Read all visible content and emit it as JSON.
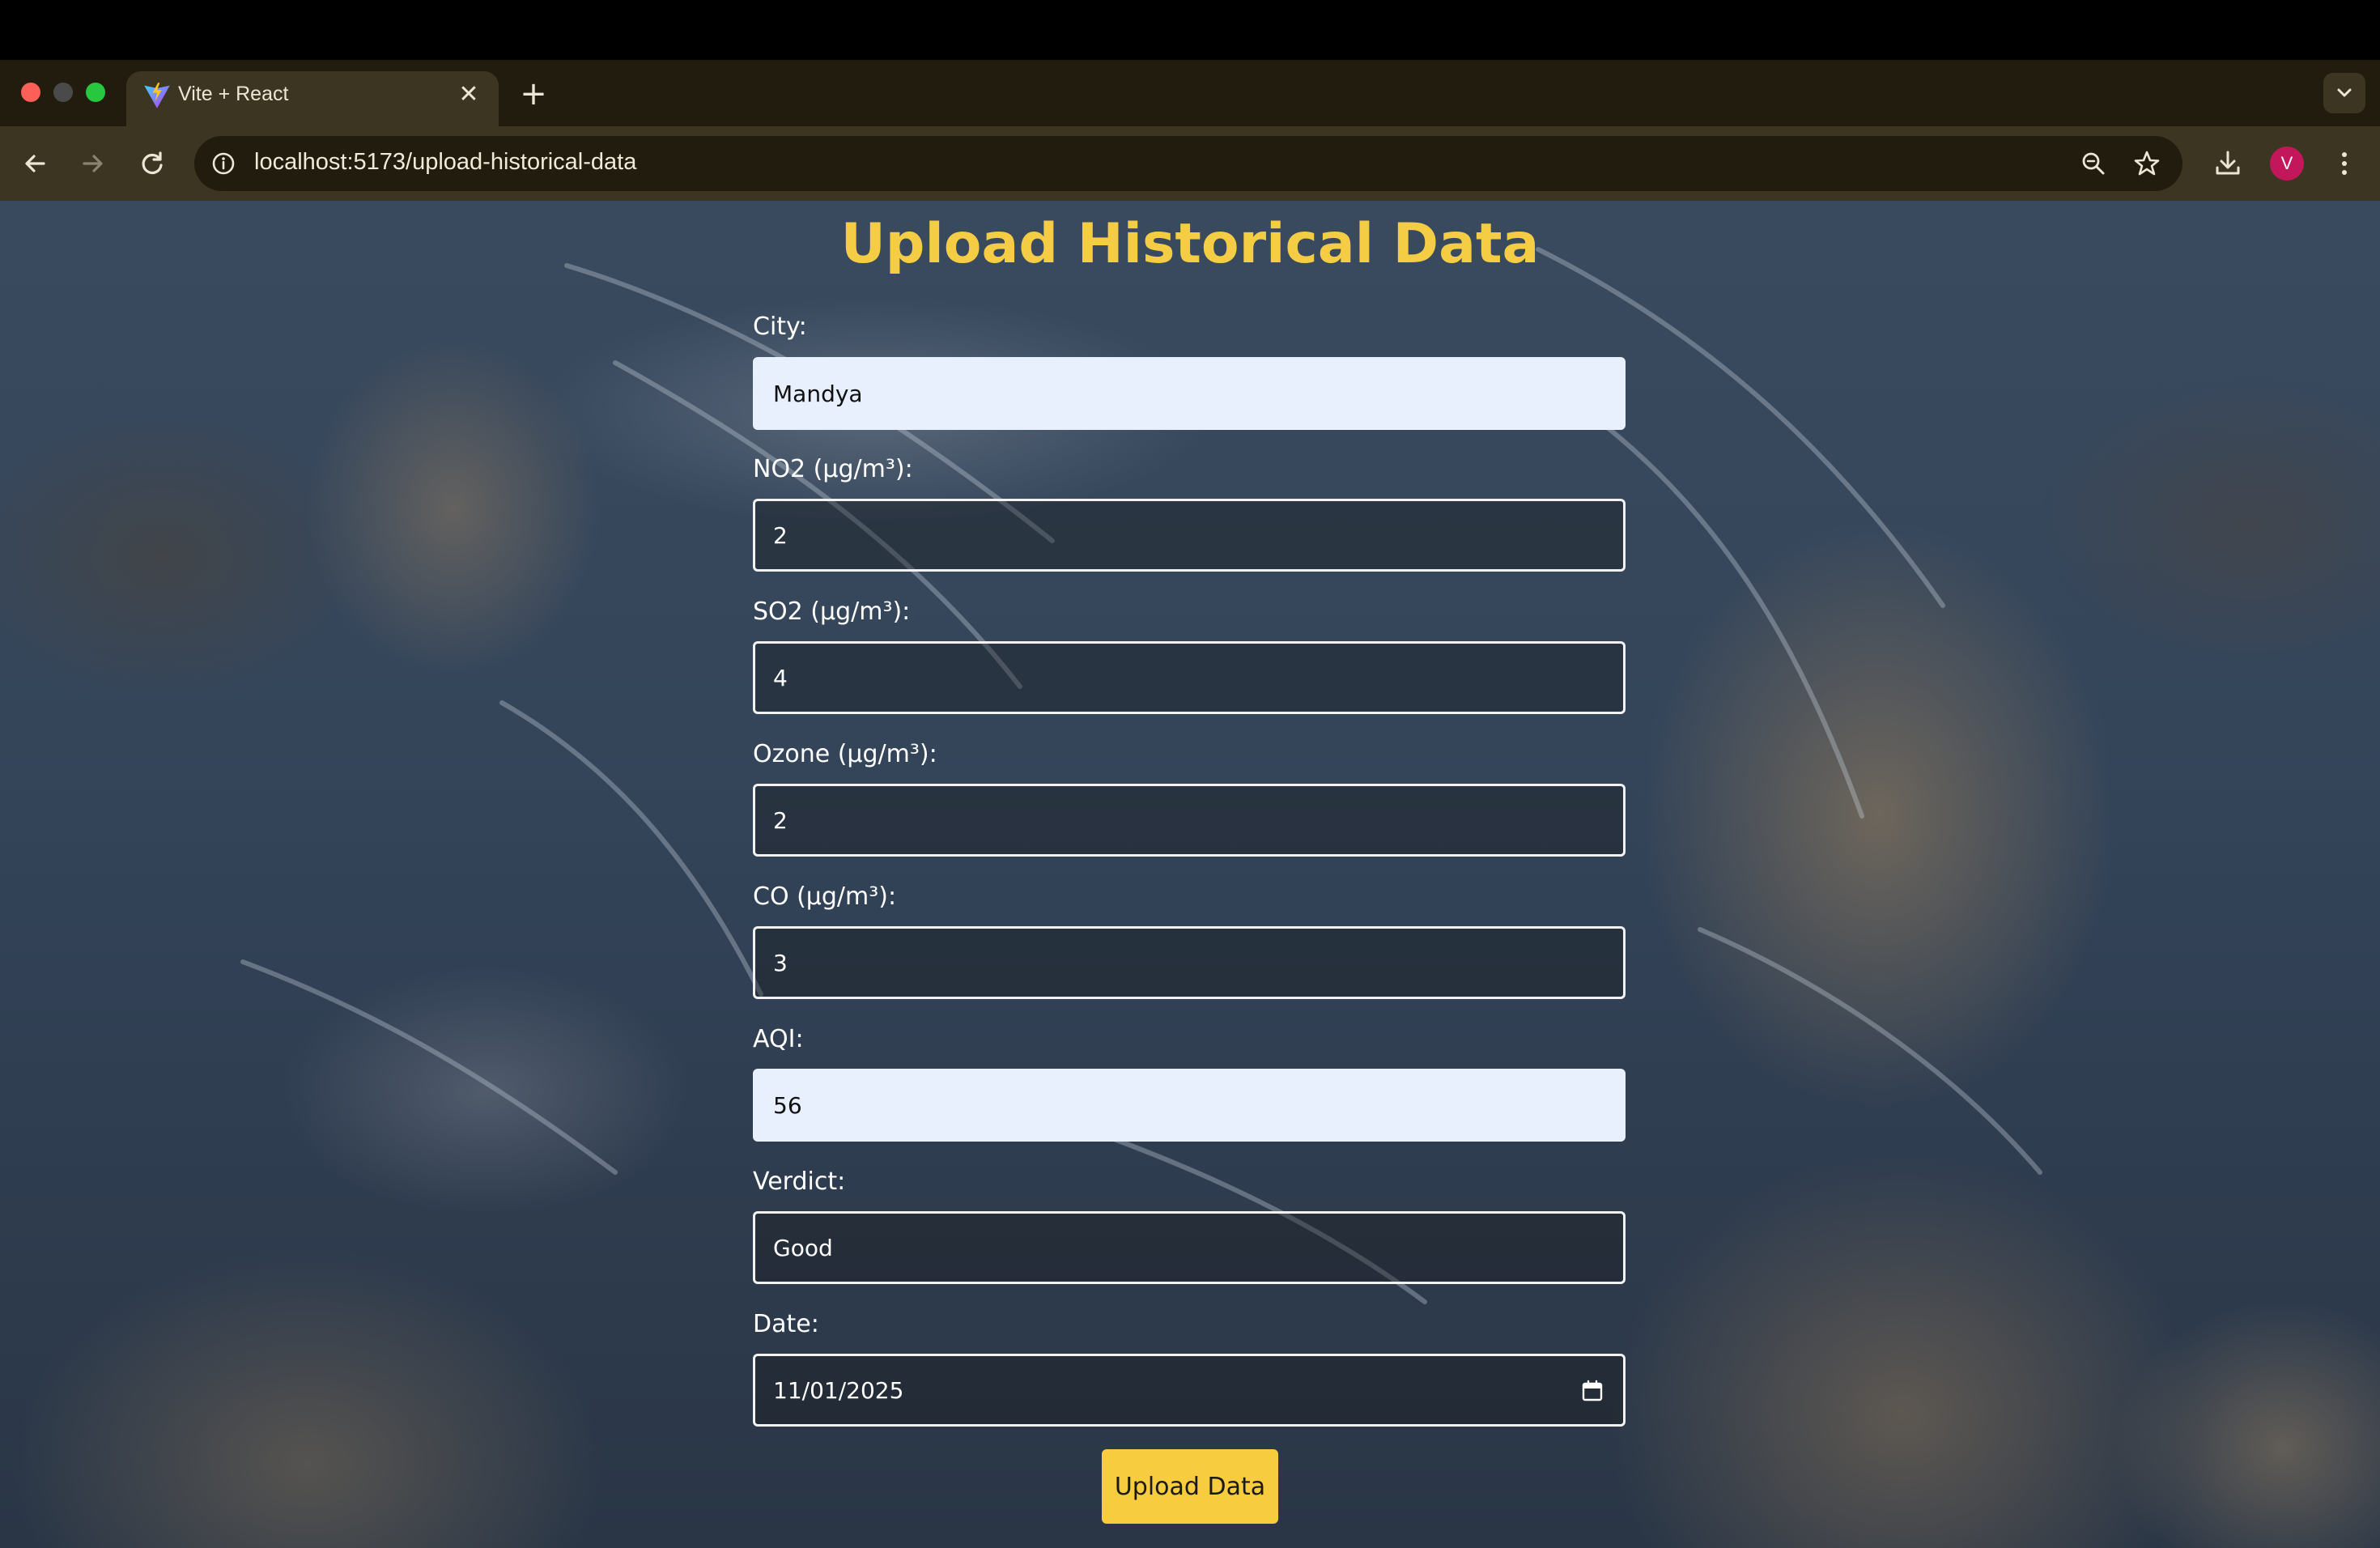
{
  "browser": {
    "tab_title": "Vite + React",
    "url": "localhost:5173/upload-historical-data",
    "avatar_initial": "V",
    "new_tab_symbol": "+",
    "close_symbol": "✕"
  },
  "icons": [
    "vite-favicon",
    "close-icon",
    "plus-icon",
    "chevron-down-icon",
    "back-arrow-icon",
    "forward-arrow-icon",
    "reload-icon",
    "site-info-icon",
    "zoom-icon",
    "star-icon",
    "download-icon",
    "more-vert-icon",
    "calendar-icon"
  ],
  "colors": {
    "accent": "#f5cd45",
    "button": "#f7cd3f",
    "autofill": "#e8f0fe"
  },
  "form": {
    "title": "Upload Historical Data",
    "fields": {
      "city": {
        "label": "City:",
        "value": "Mandya"
      },
      "no2": {
        "label": "NO2 (µg/m³):",
        "value": "2"
      },
      "so2": {
        "label": "SO2 (µg/m³):",
        "value": "4"
      },
      "ozone": {
        "label": "Ozone (µg/m³):",
        "value": "2"
      },
      "co": {
        "label": "CO (µg/m³):",
        "value": "3"
      },
      "aqi": {
        "label": "AQI:",
        "value": "56"
      },
      "verdict": {
        "label": "Verdict:",
        "value": "Good"
      },
      "date": {
        "label": "Date:",
        "value": "11/01/2025"
      }
    },
    "submit_label": "Upload Data"
  }
}
